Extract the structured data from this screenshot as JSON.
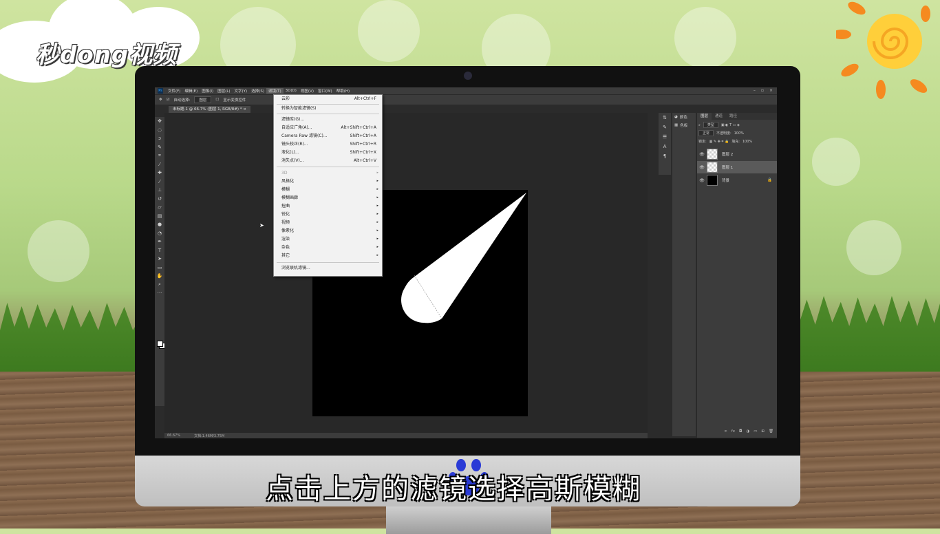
{
  "brand": {
    "logo_text": "秒dong视频"
  },
  "photoshop": {
    "menubar": [
      "文件(F)",
      "编辑(E)",
      "图像(I)",
      "图层(L)",
      "文字(Y)",
      "选择(S)",
      "滤镜(T)",
      "3D(D)",
      "视图(V)",
      "窗口(W)",
      "帮助(H)"
    ],
    "active_menu": "滤镜(T)",
    "options_bar": {
      "auto_select_label": "自动选择:",
      "auto_select_value": "图层",
      "show_transform": "显示变换控件"
    },
    "document_tab": "未标题-1 @ 66.7% (图层 1, RGB/8#) * ×",
    "status": {
      "zoom": "66.67%",
      "doc": "文档:1.46M/3.75M"
    },
    "filter_menu": {
      "items": [
        {
          "label": "云彩",
          "shortcut": "Alt+Ctrl+F"
        },
        {
          "label": "转换为智能滤镜(S)",
          "shortcut": ""
        },
        {
          "label": "滤镜库(G)...",
          "shortcut": ""
        },
        {
          "label": "自适应广角(A)...",
          "shortcut": "Alt+Shift+Ctrl+A"
        },
        {
          "label": "Camera Raw 滤镜(C)...",
          "shortcut": "Shift+Ctrl+A"
        },
        {
          "label": "镜头校正(R)...",
          "shortcut": "Shift+Ctrl+R"
        },
        {
          "label": "液化(L)...",
          "shortcut": "Shift+Ctrl+X"
        },
        {
          "label": "消失点(V)...",
          "shortcut": "Alt+Ctrl+V"
        },
        {
          "label": "3D",
          "disabled": true
        },
        {
          "label": "风格化"
        },
        {
          "label": "模糊"
        },
        {
          "label": "模糊画廊"
        },
        {
          "label": "扭曲"
        },
        {
          "label": "锐化"
        },
        {
          "label": "视频"
        },
        {
          "label": "像素化"
        },
        {
          "label": "渲染"
        },
        {
          "label": "杂色"
        },
        {
          "label": "其它"
        },
        {
          "label": "浏览联机滤镜..."
        }
      ]
    },
    "side_panels": {
      "color_label": "颜色",
      "swatches_label": "色板"
    },
    "layers_panel": {
      "tabs": [
        "图层",
        "通道",
        "路径"
      ],
      "kind_filter": "类型",
      "blend_mode": "正常",
      "opacity_label": "不透明度:",
      "opacity_value": "100%",
      "lock_label": "锁定:",
      "fill_label": "填充:",
      "fill_value": "100%",
      "layers": [
        {
          "name": "图层 2",
          "thumb": "transparent",
          "selected": false
        },
        {
          "name": "图层 1",
          "thumb": "transparent",
          "selected": true
        },
        {
          "name": "背景",
          "thumb": "black",
          "selected": false,
          "locked": true
        }
      ]
    }
  },
  "subtitle": "点击上方的滤镜选择高斯模糊"
}
